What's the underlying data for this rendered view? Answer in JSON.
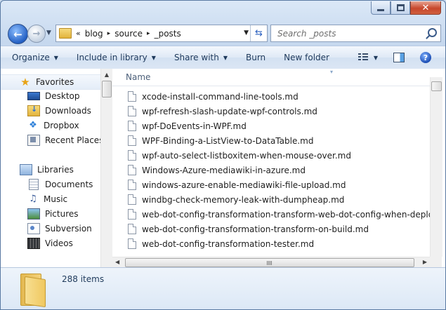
{
  "window": {
    "caption_buttons": [
      "minimize-icon",
      "maximize-icon",
      "close-icon"
    ],
    "close_glyph": "✕"
  },
  "address": {
    "overflow": "«",
    "crumbs": [
      "blog",
      "source",
      "_posts"
    ],
    "separator": "▸",
    "search_placeholder": "Search _posts"
  },
  "toolbar": {
    "organize": "Organize",
    "include_in_library": "Include in library",
    "share_with": "Share with",
    "burn": "Burn",
    "new_folder": "New folder",
    "dropdown_glyph": "▼"
  },
  "nav": {
    "favorites": {
      "label": "Favorites",
      "items": [
        "Desktop",
        "Downloads",
        "Dropbox",
        "Recent Places"
      ]
    },
    "libraries": {
      "label": "Libraries",
      "items": [
        "Documents",
        "Music",
        "Pictures",
        "Subversion",
        "Videos"
      ]
    }
  },
  "filelist": {
    "column_name": "Name",
    "files": [
      "xcode-install-command-line-tools.md",
      "wpf-refresh-slash-update-wpf-controls.md",
      "wpf-DoEvents-in-WPF.md",
      "WPF-Binding-a-ListView-to-DataTable.md",
      "wpf-auto-select-listboxitem-when-mouse-over.md",
      "Windows-Azure-mediawiki-in-azure.md",
      "windows-azure-enable-mediawiki-file-upload.md",
      "windbg-check-memory-leak-with-dumpheap.md",
      "web-dot-config-transformation-transform-web-dot-config-when-deploying-",
      "web-dot-config-transformation-transform-on-build.md",
      "web-dot-config-transformation-tester.md"
    ]
  },
  "details": {
    "item_count": "288 items"
  }
}
